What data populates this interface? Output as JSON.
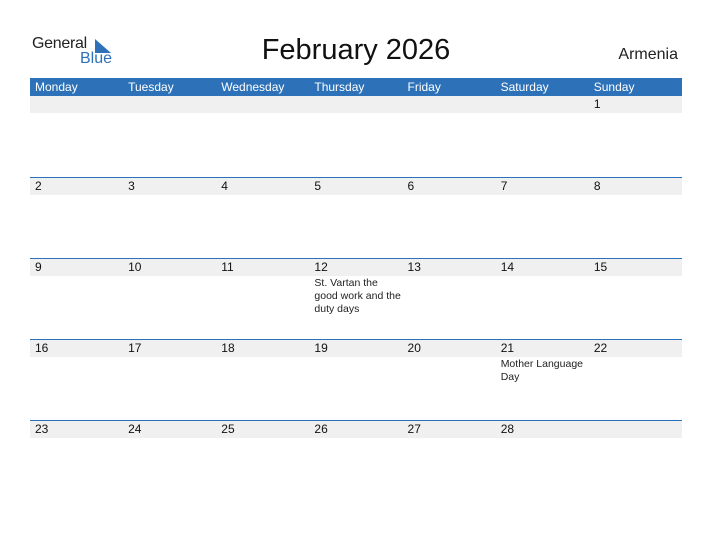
{
  "logo": {
    "word1": "General",
    "word2": "Blue",
    "icon": "triangle-flag-icon",
    "brand_color": "#2d72b8"
  },
  "title": "February 2026",
  "country": "Armenia",
  "header_color": "#2d72b8",
  "days": [
    "Monday",
    "Tuesday",
    "Wednesday",
    "Thursday",
    "Friday",
    "Saturday",
    "Sunday"
  ],
  "weeks": [
    [
      {
        "d": ""
      },
      {
        "d": ""
      },
      {
        "d": ""
      },
      {
        "d": ""
      },
      {
        "d": ""
      },
      {
        "d": ""
      },
      {
        "d": "1"
      }
    ],
    [
      {
        "d": "2"
      },
      {
        "d": "3"
      },
      {
        "d": "4"
      },
      {
        "d": "5"
      },
      {
        "d": "6"
      },
      {
        "d": "7"
      },
      {
        "d": "8"
      }
    ],
    [
      {
        "d": "9"
      },
      {
        "d": "10"
      },
      {
        "d": "11"
      },
      {
        "d": "12",
        "e": "St. Vartan the good work and the duty days"
      },
      {
        "d": "13"
      },
      {
        "d": "14"
      },
      {
        "d": "15"
      }
    ],
    [
      {
        "d": "16"
      },
      {
        "d": "17"
      },
      {
        "d": "18"
      },
      {
        "d": "19"
      },
      {
        "d": "20"
      },
      {
        "d": "21",
        "e": "Mother Language Day"
      },
      {
        "d": "22"
      }
    ],
    [
      {
        "d": "23"
      },
      {
        "d": "24"
      },
      {
        "d": "25"
      },
      {
        "d": "26"
      },
      {
        "d": "27"
      },
      {
        "d": "28"
      },
      {
        "d": ""
      }
    ]
  ]
}
